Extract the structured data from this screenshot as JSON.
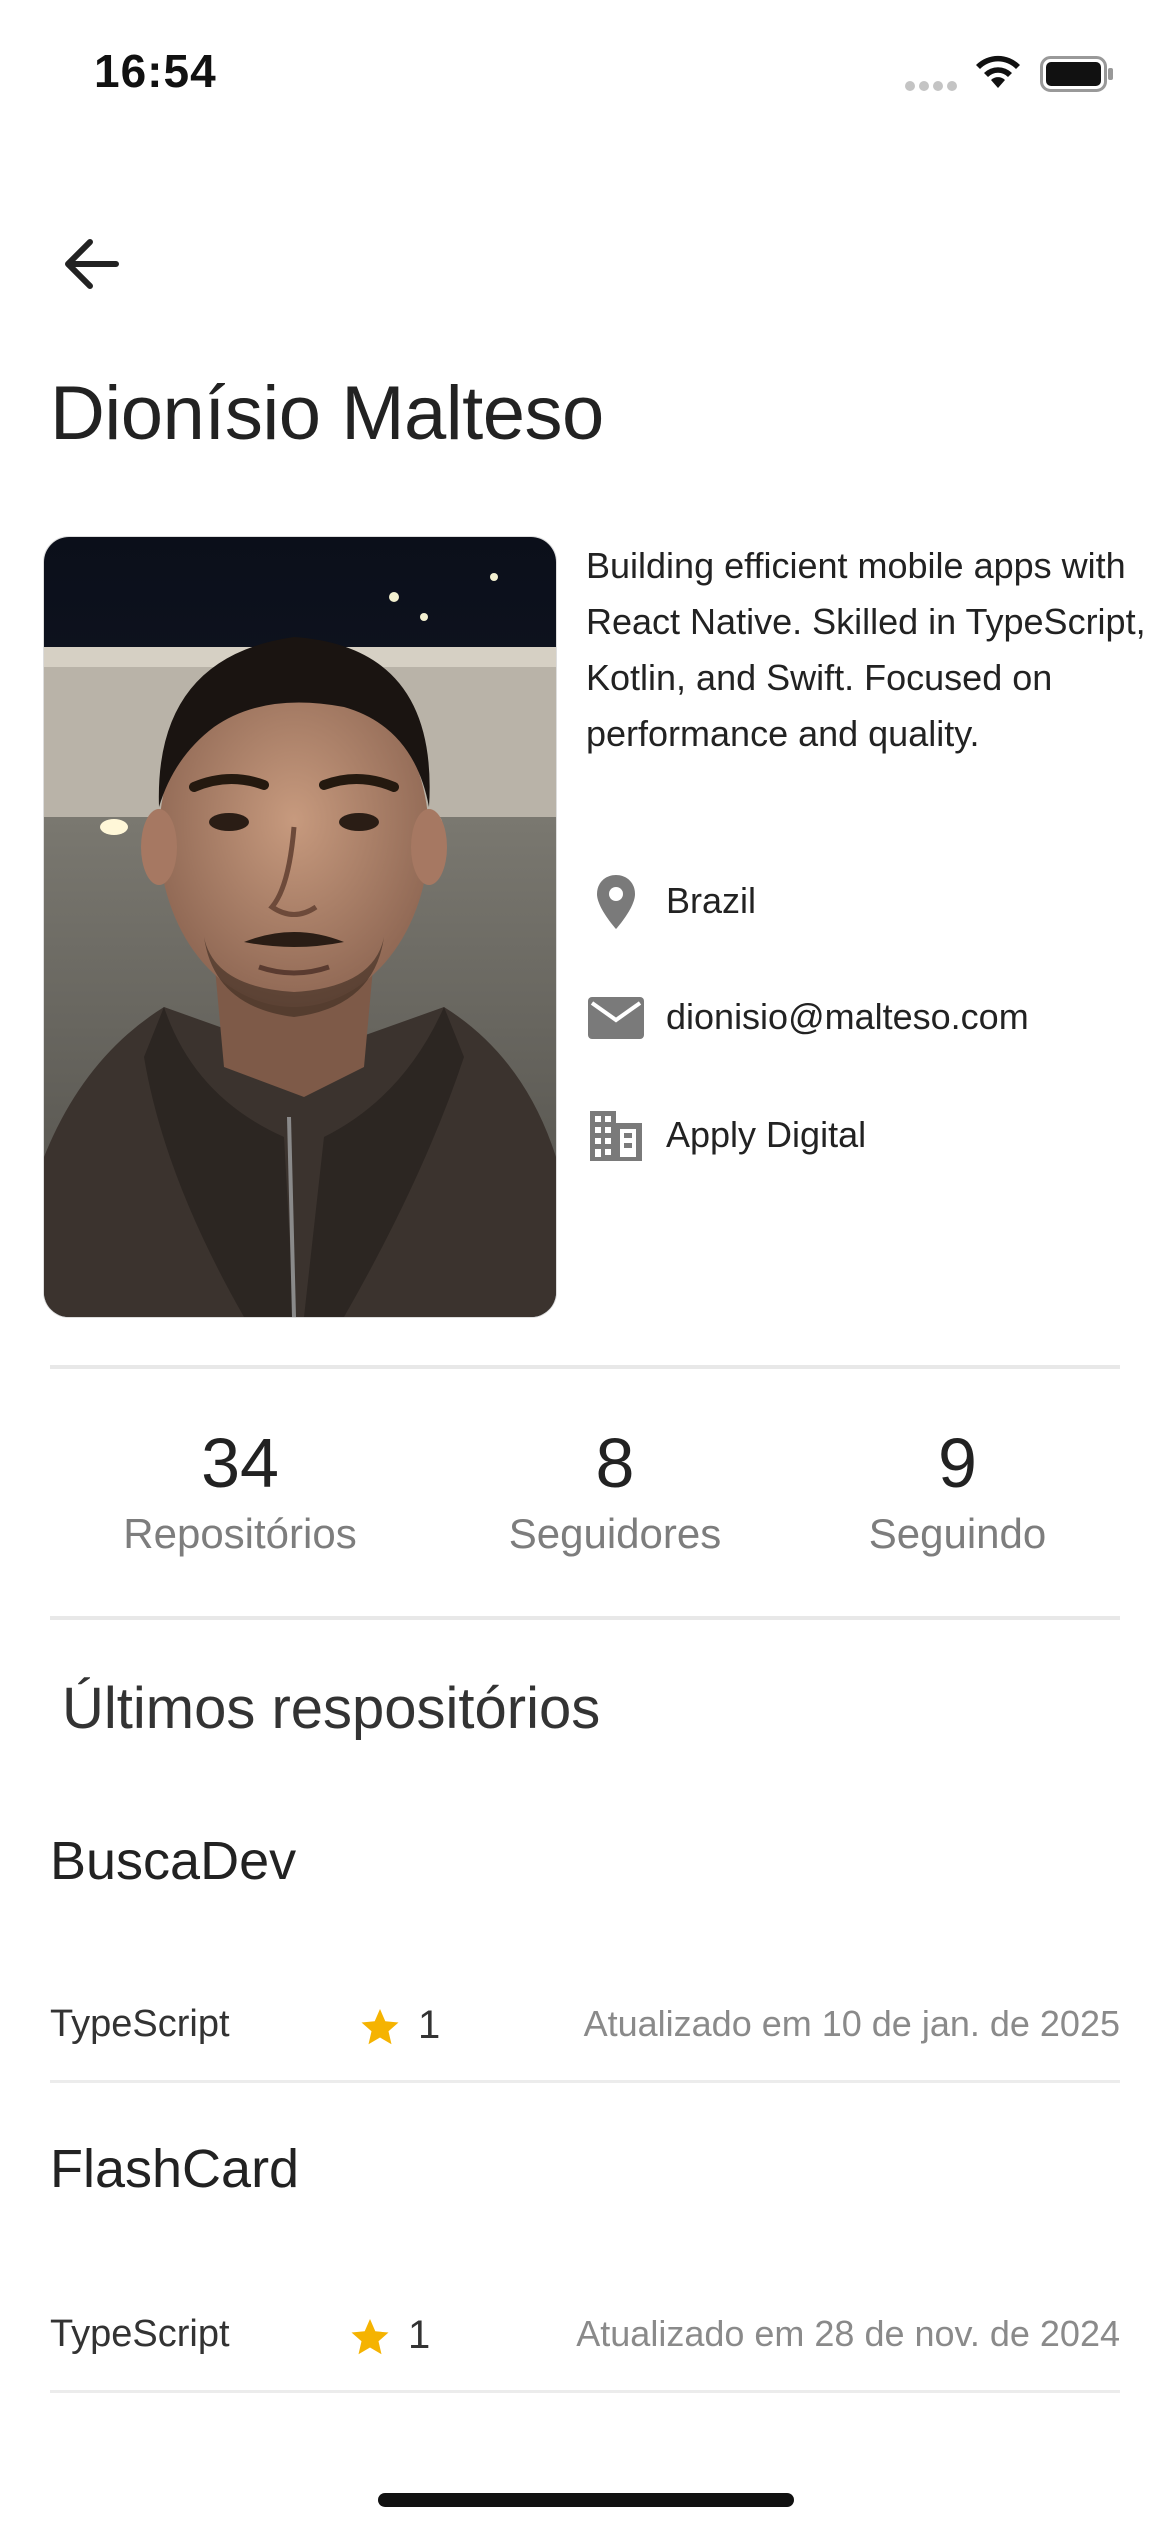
{
  "status_bar": {
    "time": "16:54"
  },
  "profile": {
    "name": "Dionísio Malteso",
    "bio": "Building efficient mobile apps with React Native. Skilled in TypeScript, Kotlin, and Swift. Focused on performance and quality.",
    "location": "Brazil",
    "email": "dionisio@malteso.com",
    "company": "Apply Digital"
  },
  "stats": [
    {
      "value": "34",
      "label": "Repositórios"
    },
    {
      "value": "8",
      "label": "Seguidores"
    },
    {
      "value": "9",
      "label": "Seguindo"
    }
  ],
  "section_title": "Últimos respositórios",
  "repos": [
    {
      "name": "BuscaDev",
      "language": "TypeScript",
      "stars": "1",
      "updated": "Atualizado em 10 de jan. de 2025"
    },
    {
      "name": "FlashCard",
      "language": "TypeScript",
      "stars": "1",
      "updated": "Atualizado em 28 de nov. de 2024"
    }
  ],
  "icons": {
    "back": "arrow-left-icon",
    "location": "map-pin-icon",
    "email": "mail-icon",
    "company": "building-icon",
    "star": "star-icon"
  },
  "colors": {
    "star": "#F5B301",
    "icon_gray": "#7a7a7a",
    "muted_text": "#7d7d7d"
  }
}
